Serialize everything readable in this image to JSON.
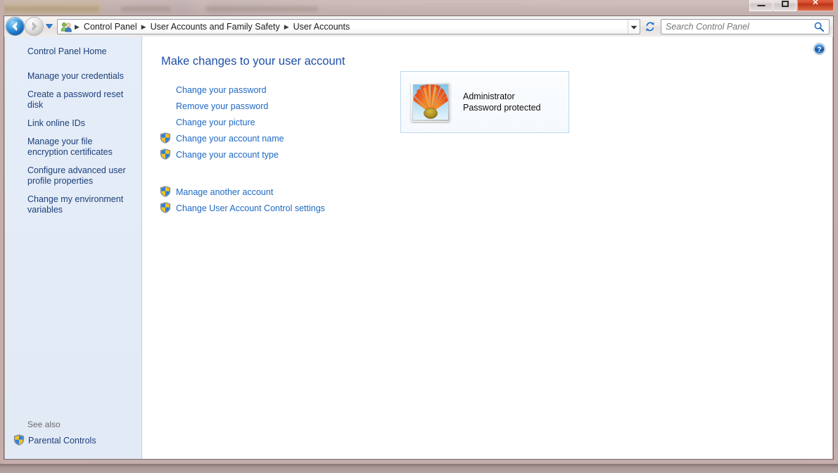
{
  "window": {
    "caption_buttons": [
      {
        "name": "minimize",
        "glyph": ""
      },
      {
        "name": "maximize",
        "glyph": ""
      },
      {
        "name": "close",
        "glyph": "✕"
      }
    ]
  },
  "toolbar": {
    "back_label": "Back",
    "forward_label": "Forward",
    "recent_pages_label": "Recent pages",
    "breadcrumb_icon": "user-accounts-icon",
    "breadcrumbs": [
      "Control Panel",
      "User Accounts and Family Safety",
      "User Accounts"
    ],
    "separator": "▶",
    "address_caret_label": "Previous locations",
    "refresh_label": "Refresh",
    "search": {
      "placeholder": "Search Control Panel",
      "value": "",
      "icon": "search-icon"
    }
  },
  "sidebar": {
    "home_label": "Control Panel Home",
    "items": [
      {
        "label": "Manage your credentials"
      },
      {
        "label": "Create a password reset disk"
      },
      {
        "label": "Link online IDs"
      },
      {
        "label": "Manage your file encryption certificates"
      },
      {
        "label": "Configure advanced user profile properties"
      },
      {
        "label": "Change my environment variables"
      }
    ],
    "see_also_title": "See also",
    "see_also_items": [
      {
        "label": "Parental Controls",
        "icon": "uac-shield-icon"
      }
    ]
  },
  "content": {
    "help_label": "Help",
    "title": "Make changes to your user account",
    "tasks_primary": [
      {
        "label": "Change your password",
        "shield": false
      },
      {
        "label": "Remove your password",
        "shield": false
      },
      {
        "label": "Change your picture",
        "shield": false
      },
      {
        "label": "Change your account name",
        "shield": true
      },
      {
        "label": "Change your account type",
        "shield": true
      }
    ],
    "tasks_secondary": [
      {
        "label": "Manage another account",
        "shield": true
      },
      {
        "label": "Change User Account Control settings",
        "shield": true
      }
    ],
    "account": {
      "avatar_icon": "flower-avatar",
      "name": "Administrator",
      "status": "Password protected"
    }
  },
  "colors": {
    "link_blue": "#1d68c4",
    "sidebar_link_blue": "#1c3f7a",
    "heading_blue": "#1f4fa8",
    "sidebar_bg": "#e3ebf7",
    "close_button_red": "#d64a28"
  }
}
